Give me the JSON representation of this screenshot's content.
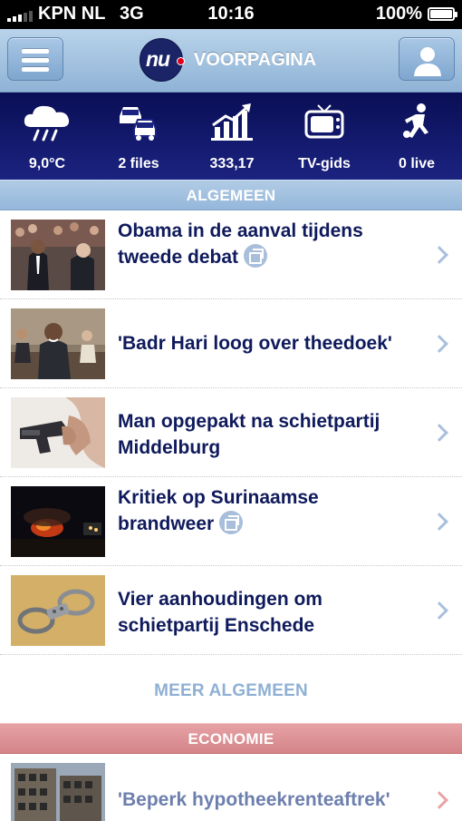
{
  "status_bar": {
    "carrier": "KPN NL",
    "network": "3G",
    "time": "10:16",
    "battery": "100%",
    "battery_level": 1.0,
    "signal_bars_filled": 3,
    "signal_bars_total": 5
  },
  "nav": {
    "menu_icon": "hamburger-menu-icon",
    "logo_text": "nu",
    "title": "VOORPAGINA",
    "profile_icon": "user-profile-icon"
  },
  "widgets": [
    {
      "icon": "rain-cloud-icon",
      "label": "9,0°C"
    },
    {
      "icon": "traffic-cars-icon",
      "label": "2 files"
    },
    {
      "icon": "stock-chart-icon",
      "label": "333,17"
    },
    {
      "icon": "tv-icon",
      "label": "TV-gids"
    },
    {
      "icon": "football-player-icon",
      "label": "0 live"
    }
  ],
  "sections": {
    "algemeen": {
      "title": "ALGEMEEN",
      "articles": [
        {
          "headline": "Obama in de aanval tijdens tweede debat",
          "has_gallery": true
        },
        {
          "headline": "'Badr Hari loog over theedoek'",
          "has_gallery": false
        },
        {
          "headline": "Man opgepakt na schietpartij Middelburg",
          "has_gallery": false
        },
        {
          "headline": "Kritiek op Surinaamse brandweer",
          "has_gallery": true
        },
        {
          "headline": "Vier aanhoudingen om schietpartij Enschede",
          "has_gallery": false
        }
      ],
      "more_label": "MEER ALGEMEEN"
    },
    "economie": {
      "title": "ECONOMIE",
      "articles": [
        {
          "headline": "'Beperk hypotheekrenteaftrek'",
          "has_gallery": false
        }
      ]
    }
  },
  "colors": {
    "nav_blue": "#8fb3d6",
    "widget_navy": "#0a0e55",
    "headline_navy": "#0f1a5c",
    "economie_red": "#d48488",
    "logo_red_dot": "#e0001b"
  }
}
